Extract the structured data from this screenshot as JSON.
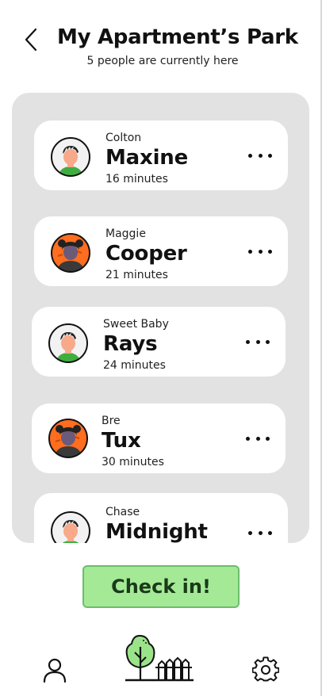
{
  "header": {
    "title": "My Apartment’s Park",
    "subtitle": "5 people are currently here"
  },
  "checkins": [
    {
      "owner": "Colton",
      "pet": "Maxine",
      "duration": "16 minutes",
      "avatar": "boy-avatar-icon"
    },
    {
      "owner": "Maggie",
      "pet": "Cooper",
      "duration": "21 minutes",
      "avatar": "girl-avatar-icon"
    },
    {
      "owner": "Sweet Baby",
      "pet": "Rays",
      "duration": "24 minutes",
      "avatar": "boy-avatar-icon"
    },
    {
      "owner": "Bre",
      "pet": "Tux",
      "duration": "30 minutes",
      "avatar": "girl-avatar-icon"
    },
    {
      "owner": "Chase",
      "pet": "Midnight",
      "duration": "",
      "avatar": "boy-avatar-icon"
    }
  ],
  "checkin_button": {
    "label": "Check in!"
  },
  "nav": {
    "items": [
      "profile-icon",
      "park-icon",
      "settings-icon"
    ]
  },
  "colors": {
    "panel": "#e2e2e2",
    "button": "#a4ea96",
    "button_border": "#6cbd6c",
    "avatar_orange": "#ff6d1f",
    "tree_green": "#9be38a"
  }
}
